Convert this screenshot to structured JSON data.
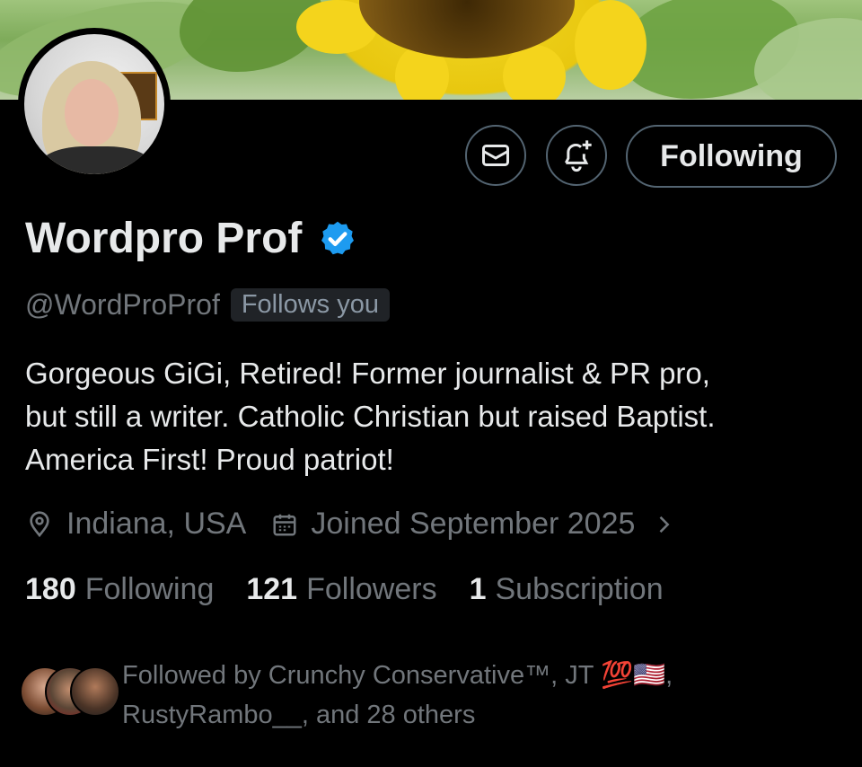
{
  "profile": {
    "display_name": "Wordpro Prof",
    "handle": "@WordProProf",
    "follows_you_label": "Follows you",
    "bio_lines": [
      "Gorgeous GiGi, Retired! Former journalist & PR pro,",
      "but still a writer. Catholic Christian but raised Baptist.",
      "America First! Proud patriot!"
    ],
    "location": "Indiana, USA",
    "joined": "Joined September 2025"
  },
  "actions": {
    "following_label": "Following"
  },
  "stats": {
    "following_count": "180",
    "following_label": "Following",
    "followers_count": "121",
    "followers_label": "Followers",
    "subscription_count": "1",
    "subscription_label": "Subscription"
  },
  "followed_by": {
    "line1": "Followed by Crunchy Conservative™, JT 💯🇺🇸,",
    "line2": "RustyRambo__, and 28 others"
  },
  "icons": {
    "message": "envelope-icon",
    "notify": "bell-plus-icon",
    "verified": "verified-badge-icon",
    "location": "location-pin-icon",
    "calendar": "calendar-icon",
    "chevron": "chevron-right-icon"
  },
  "colors": {
    "background": "#000000",
    "primary_text": "#e7e9ea",
    "secondary_text": "#71767b",
    "verified_blue": "#1d9bf0",
    "border": "#536471"
  }
}
